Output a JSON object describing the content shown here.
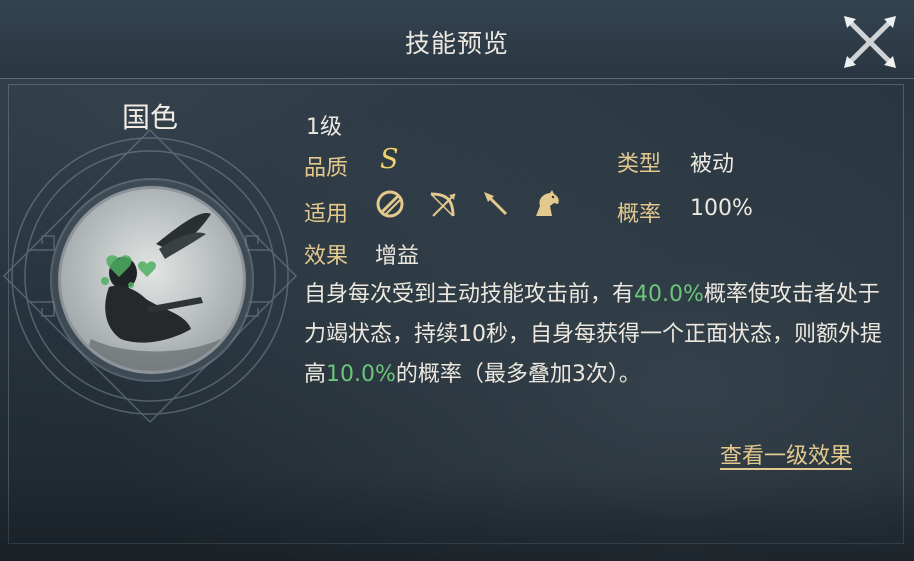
{
  "header": {
    "title": "技能预览"
  },
  "skill": {
    "name": "国色",
    "level": "1级",
    "quality_label": "品质",
    "quality_value": "S",
    "type_label": "类型",
    "type_value": "被动",
    "applies_label": "适用",
    "applies_icons": [
      "shield-icon",
      "bow-icon",
      "spear-icon",
      "horse-icon"
    ],
    "chance_label": "概率",
    "chance_value": "100%",
    "effect_label": "效果",
    "effect_value": "增益",
    "description": {
      "part1": "自身每次受到主动技能攻击前，有",
      "hl1": "40.0%",
      "part2": "概率使攻击者处于力竭状态，持续10秒，自身每获得一个正面状态，则额外提高",
      "hl2": "10.0%",
      "part3": "的概率（最多叠加3次）。"
    }
  },
  "actions": {
    "view_level1": "查看一级效果"
  },
  "colors": {
    "label_gold": "#e3c98d",
    "highlight_green": "#6bc67a",
    "grade_gold": "#f1d26b"
  }
}
